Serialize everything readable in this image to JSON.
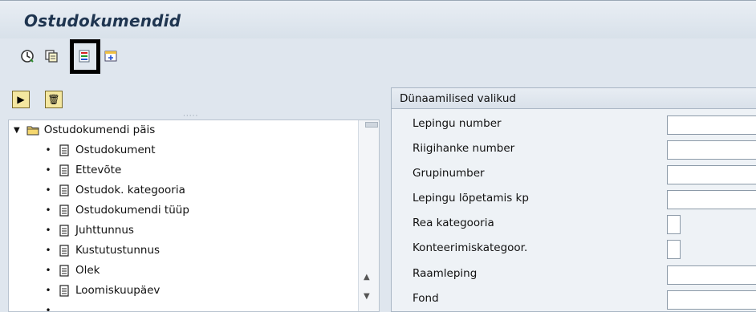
{
  "window": {
    "title": "Ostudokumendid"
  },
  "toolbar": {
    "icons": [
      "execute-icon",
      "copy-icon",
      "dynamic-selections-icon",
      "select-options-icon"
    ]
  },
  "left_panel": {
    "buttons": {
      "expand": "▶",
      "delete": "🗑"
    },
    "tree": {
      "root_label": "Ostudokumendi päis",
      "items": [
        "Ostudokument",
        "Ettevõte",
        "Ostudok. kategooria",
        "Ostudokumendi tüüp",
        "Juhttunnus",
        "Kustutustunnus",
        "Olek",
        "Loomiskuupäev"
      ]
    }
  },
  "right_panel": {
    "header": "Dünaamilised valikud",
    "fields": [
      {
        "label": "Lepingu number",
        "value": ""
      },
      {
        "label": "Riigihanke number",
        "value": ""
      },
      {
        "label": "Grupinumber",
        "value": ""
      },
      {
        "label": "Lepingu lõpetamis kp",
        "value": ""
      },
      {
        "label": "Rea kategooria",
        "value": ""
      },
      {
        "label": "Konteerimiskategoor.",
        "value": ""
      },
      {
        "label": "Raamleping",
        "value": ""
      },
      {
        "label": "Fond",
        "value": ""
      }
    ]
  }
}
